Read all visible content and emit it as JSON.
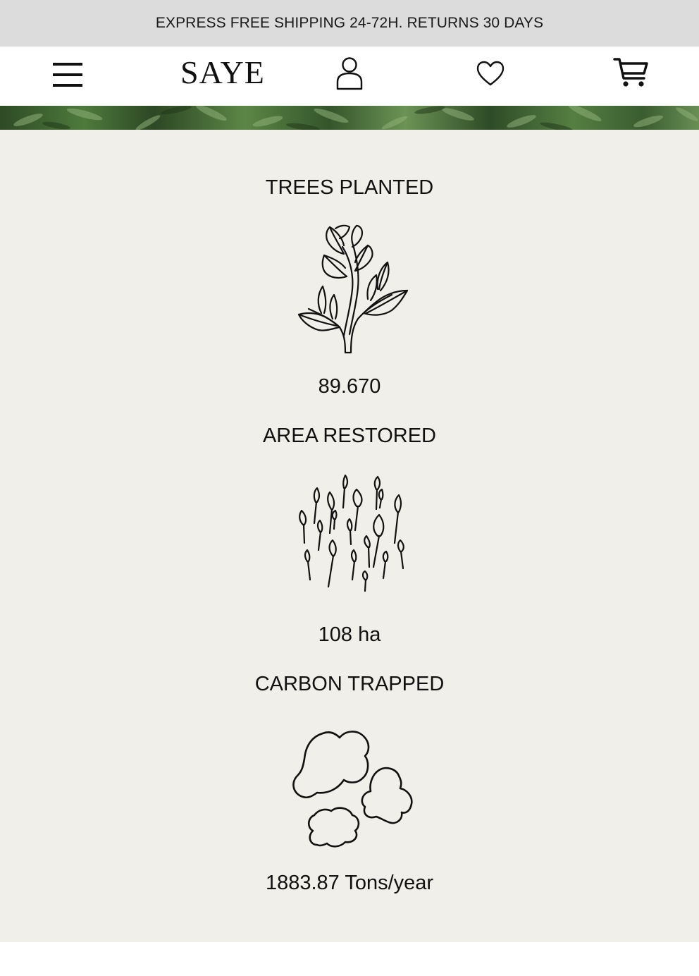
{
  "promo": {
    "text": "EXPRESS FREE SHIPPING 24-72H. RETURNS 30 DAYS"
  },
  "header": {
    "logo": "SAYE",
    "icons": [
      "menu-icon",
      "user-icon",
      "heart-icon",
      "cart-icon"
    ]
  },
  "impact": {
    "stats": [
      {
        "title": "TREES PLANTED",
        "value": "89.670",
        "icon": "tree-sprout-icon"
      },
      {
        "title": "AREA RESTORED",
        "value": "108 ha",
        "icon": "seedlings-icon"
      },
      {
        "title": "CARBON TRAPPED",
        "value": "1883.87 Tons/year",
        "icon": "clouds-icon"
      }
    ]
  },
  "colors": {
    "promo_bg": "#dcdcdc",
    "impact_bg": "#f0efe9",
    "text": "#111111",
    "foliage": "#4e7a3c"
  }
}
